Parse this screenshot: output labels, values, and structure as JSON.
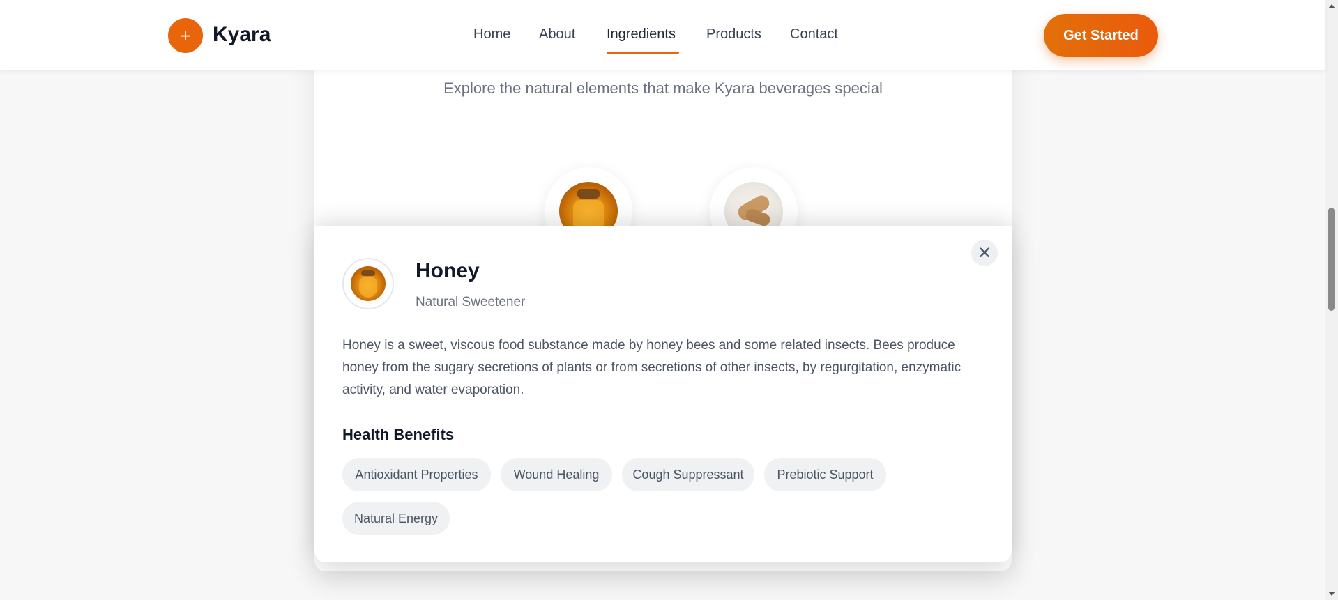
{
  "header": {
    "logo_symbol": "+",
    "brand": "Kyara",
    "nav": [
      {
        "label": "Home"
      },
      {
        "label": "About"
      },
      {
        "label": "Ingredients"
      },
      {
        "label": "Products"
      },
      {
        "label": "Contact"
      }
    ],
    "active_nav": "Ingredients",
    "cta_label": "Get Started"
  },
  "section": {
    "subtitle": "Explore the natural elements that make Kyara beverages special",
    "ingredients": [
      {
        "icon": "honey-jar-image"
      },
      {
        "icon": "ginger-root-image"
      }
    ]
  },
  "modal": {
    "close_symbol": "✕",
    "icon": "honey-jar-image",
    "title": "Honey",
    "subtitle": "Natural Sweetener",
    "description": "Honey is a sweet, viscous food substance made by honey bees and some related insects. Bees produce honey from the sugary secretions of plants or from secretions of other insects, by regurgitation, enzymatic activity, and water evaporation.",
    "benefits_heading": "Health Benefits",
    "benefits": [
      "Antioxidant Properties",
      "Wound Healing",
      "Cough Suppressant",
      "Prebiotic Support",
      "Natural Energy"
    ]
  },
  "colors": {
    "accent": "#e8650c",
    "text_dark": "#111827",
    "text_muted": "#6b7280",
    "tag_bg": "#f0f1f3"
  }
}
